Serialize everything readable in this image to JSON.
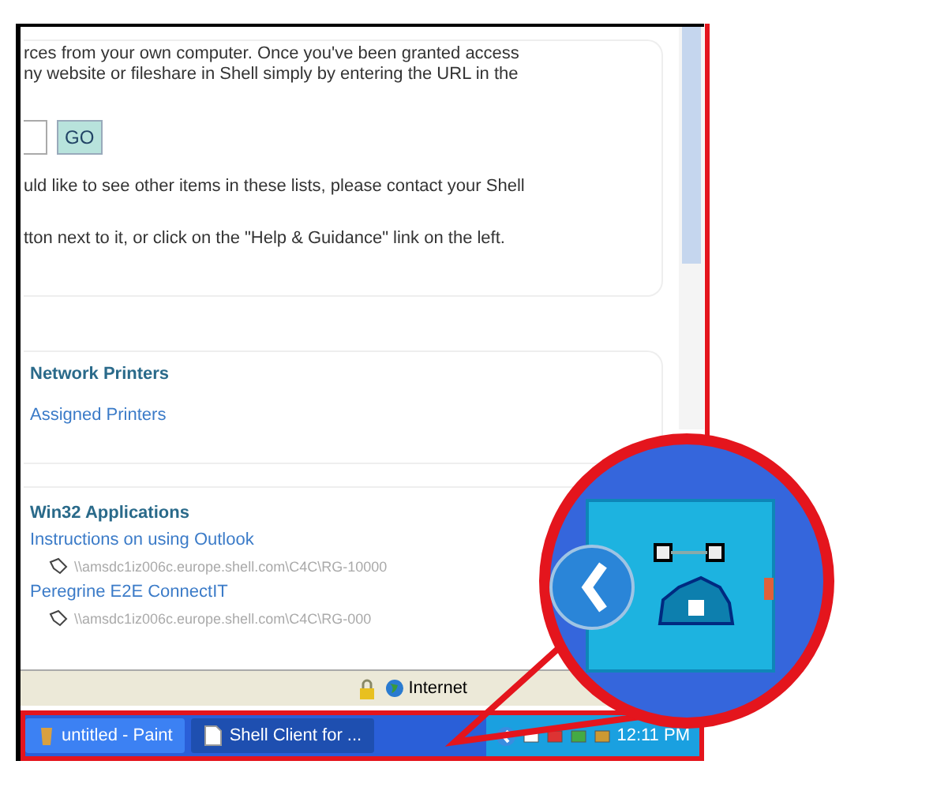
{
  "page": {
    "intro_lines": [
      "rces from your own computer. Once you've been granted access",
      "ny website or fileshare in Shell simply by entering the URL in the"
    ],
    "go_button": "GO",
    "notice_lines": [
      "uld like to see other items in these lists, please contact your Shell",
      "tton next to it, or click on the \"Help & Guidance\" link on the left."
    ]
  },
  "sections": [
    {
      "title": "Network Printers",
      "items": [
        {
          "label": "Assigned Printers"
        }
      ]
    },
    {
      "title": "Win32 Applications",
      "items": [
        {
          "label": "Instructions on using Outlook",
          "path": "\\\\amsdc1iz006c.europe.shell.com\\C4C\\RG-10000"
        },
        {
          "label": "Peregrine E2E ConnectIT",
          "path": "\\\\amsdc1iz006c.europe.shell.com\\C4C\\RG-000"
        }
      ]
    }
  ],
  "status_bar": {
    "zone": "Internet"
  },
  "taskbar": {
    "buttons": [
      {
        "label": "untitled - Paint",
        "selected": false
      },
      {
        "label": "Shell Client for ...",
        "selected": true
      }
    ],
    "clock": "12:11 PM"
  }
}
